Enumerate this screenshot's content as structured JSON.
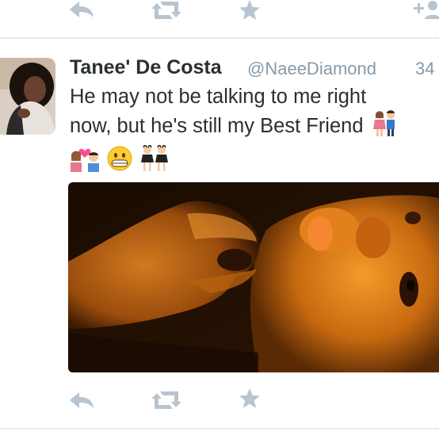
{
  "top_actions": {
    "reply_icon": "reply-icon",
    "retweet_icon": "retweet-icon",
    "favorite_icon": "star-icon",
    "follow_icon": "add-user-icon"
  },
  "tweet": {
    "author_name": "Tanee' De Costa",
    "author_handle": "@NaeeDiamond",
    "timestamp": "34",
    "text_line1": "He may not be talking to me right",
    "text_line2": "now, but he's still my Best Friend",
    "emojis": [
      "couple-holding-hands-emoji",
      "kiss-couple-emoji",
      "grinning-emoji",
      "dancers-emoji"
    ],
    "media_alt_icon": "photo",
    "actions": {
      "reply_icon": "reply-icon",
      "retweet_icon": "retweet-icon",
      "favorite_icon": "star-icon"
    }
  },
  "colors": {
    "text": "#292f33",
    "muted": "#8899a6",
    "icon": "#b8c4cf",
    "divider": "#e6ecf0"
  }
}
